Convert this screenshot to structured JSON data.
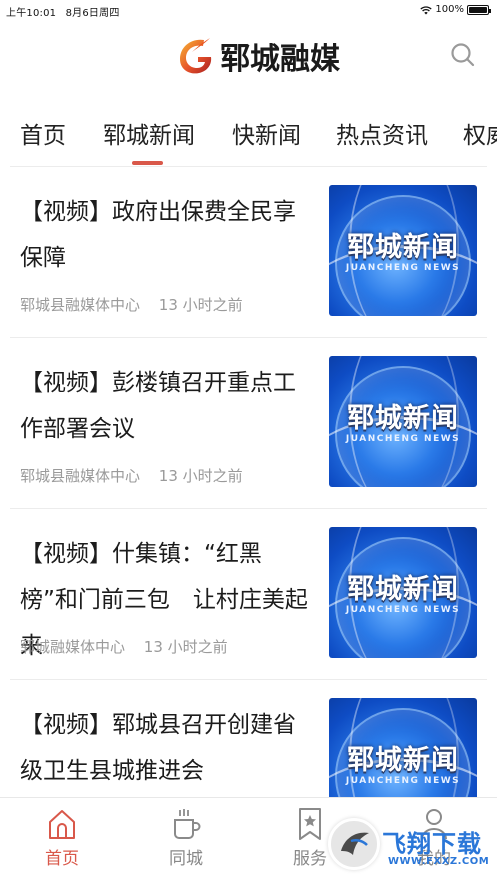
{
  "status_bar": {
    "time": "上午10:01",
    "date": "8月6日周四",
    "battery": "100%",
    "battery_level": 1.0
  },
  "header": {
    "app_name": "郓城融媒",
    "logo_icon": "flame-g-logo",
    "search_icon": "search-icon"
  },
  "tabs": [
    {
      "label": "首页",
      "active": false
    },
    {
      "label": "郓城新闻",
      "active": true
    },
    {
      "label": "快新闻",
      "active": false
    },
    {
      "label": "热点资讯",
      "active": false
    },
    {
      "label": "权威",
      "active": false
    }
  ],
  "news": [
    {
      "title": "【视频】政府出保费全民享保障",
      "source": "郓城县融媒体中心",
      "time": "13 小时之前",
      "thumb_title": "郓城新闻",
      "thumb_subtitle": "JUANCHENG NEWS"
    },
    {
      "title": "【视频】彭楼镇召开重点工作部署会议",
      "source": "郓城县融媒体中心",
      "time": "13 小时之前",
      "thumb_title": "郓城新闻",
      "thumb_subtitle": "JUANCHENG NEWS"
    },
    {
      "title": "【视频】什集镇：“红黑榜”和门前三包　让村庄美起来",
      "source": "郓城融媒体中心",
      "time": "13 小时之前",
      "thumb_title": "郓城新闻",
      "thumb_subtitle": "JUANCHENG NEWS"
    },
    {
      "title": "【视频】郓城县召开创建省级卫生县城推进会",
      "source": "",
      "time": "",
      "thumb_title": "郓城新闻",
      "thumb_subtitle": "JUANCHENG NEWS"
    }
  ],
  "bottom_nav": [
    {
      "label": "首页",
      "icon": "home-icon",
      "active": true
    },
    {
      "label": "同城",
      "icon": "coffee-cup-icon",
      "active": false
    },
    {
      "label": "服务",
      "icon": "bookmark-star-icon",
      "active": false
    },
    {
      "label": "我的",
      "icon": "user-icon",
      "active": false
    }
  ],
  "watermark": {
    "text": "飞翔下载",
    "url": "WWW.FXXZ.COM"
  },
  "colors": {
    "accent": "#d9584a",
    "text": "#222222",
    "meta": "#9a9a9a",
    "thumb_blue": "#1f66d8",
    "watermark_blue": "#2b77d8"
  }
}
